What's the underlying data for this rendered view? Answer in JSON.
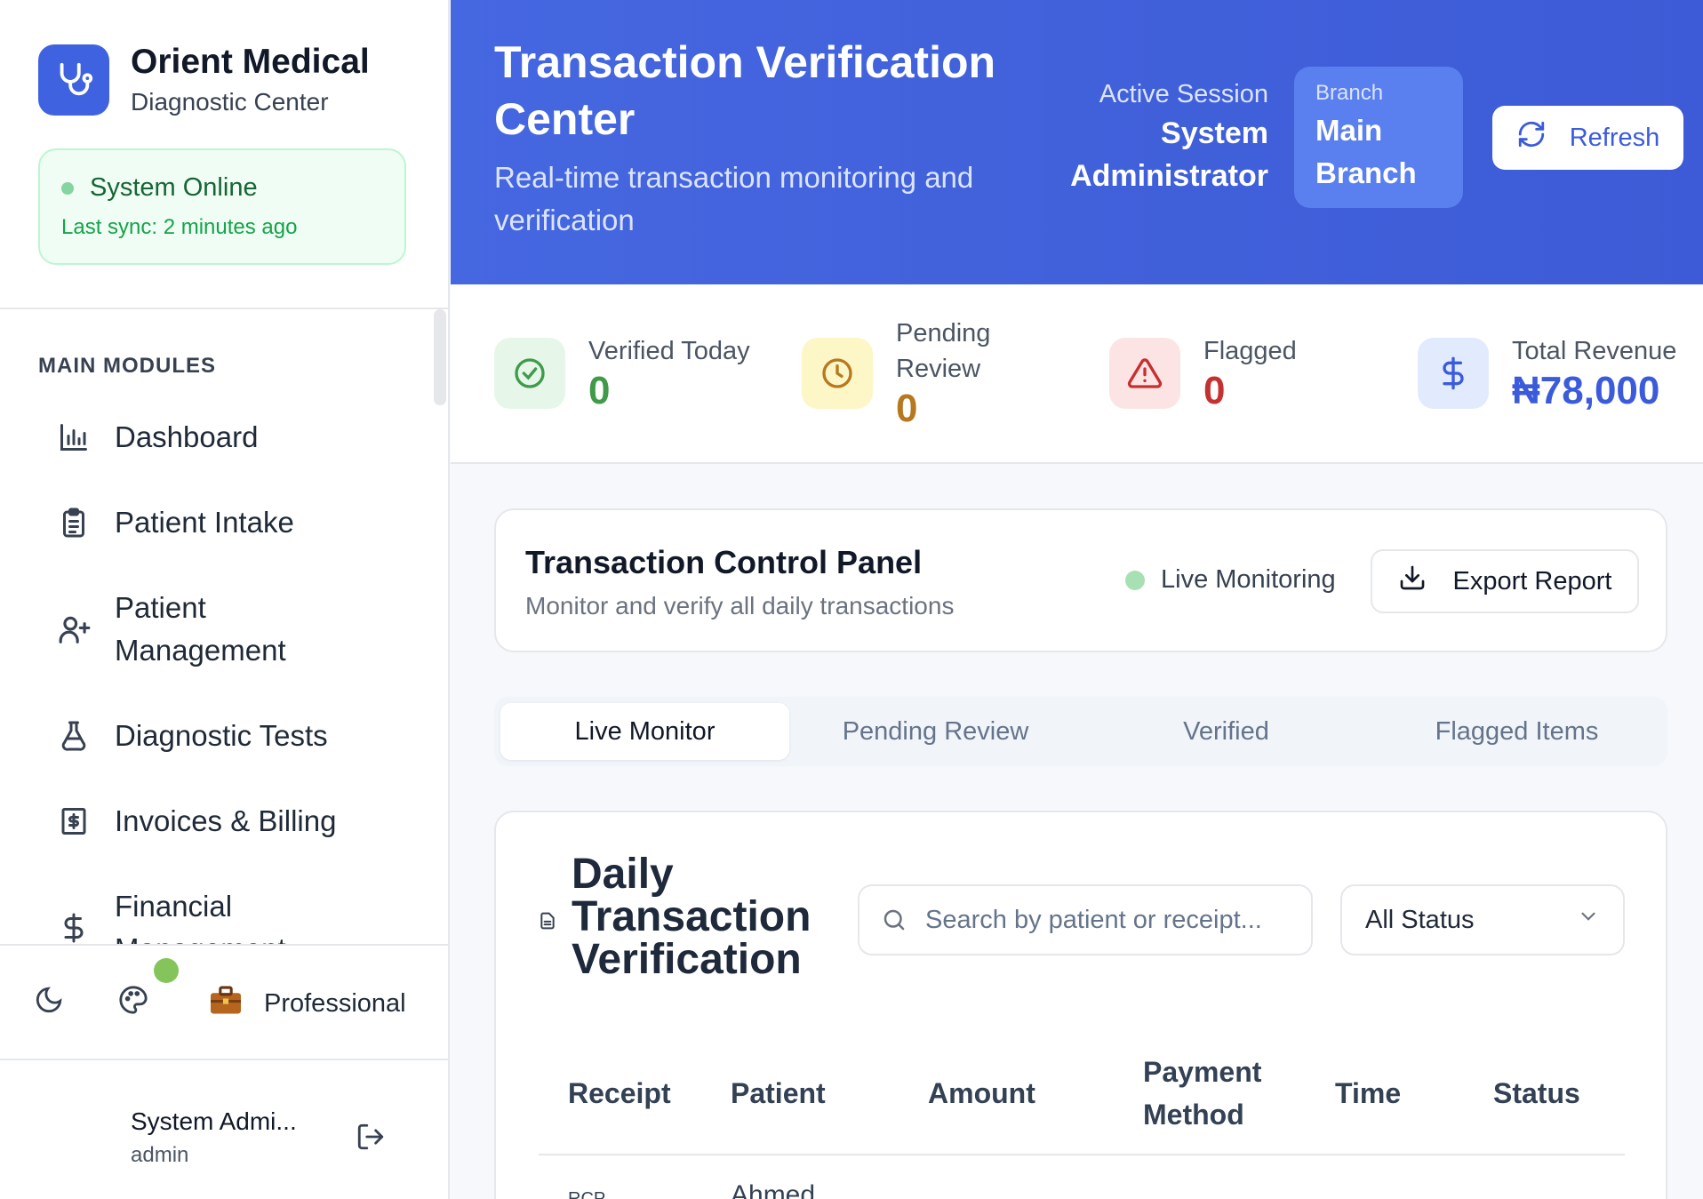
{
  "sidebar": {
    "brand_name": "Orient Medical",
    "brand_sub": "Diagnostic Center",
    "status_title": "System Online",
    "status_sync": "Last sync: 2 minutes ago",
    "section_heading": "MAIN MODULES",
    "items": [
      {
        "label": "Dashboard",
        "icon": "bar-chart-icon"
      },
      {
        "label": "Patient Intake",
        "icon": "clipboard-icon"
      },
      {
        "label": "Patient Management",
        "icon": "user-plus-icon"
      },
      {
        "label": "Diagnostic Tests",
        "icon": "flask-icon"
      },
      {
        "label": "Invoices & Billing",
        "icon": "receipt-icon"
      },
      {
        "label": "Financial Management",
        "icon": "dollar-icon"
      }
    ],
    "theme_label": "Professional",
    "user_name": "System Admi...",
    "user_role": "admin"
  },
  "header": {
    "title": "Transaction Verification Center",
    "subtitle": "Real-time transaction monitoring and verification",
    "session_label": "Active Session",
    "session_value": "System Administrator",
    "branch_label": "Branch",
    "branch_value": "Main Branch",
    "refresh_label": "Refresh"
  },
  "stats": [
    {
      "label": "Verified Today",
      "value": "0",
      "color": "#3f9a4a",
      "icon": "check-circle-icon"
    },
    {
      "label": "Pending Review",
      "value": "0",
      "color": "#b7791f",
      "icon": "clock-icon"
    },
    {
      "label": "Flagged",
      "value": "0",
      "color": "#c53030",
      "icon": "warning-icon"
    },
    {
      "label": "Total Revenue",
      "value": "₦78,000",
      "color": "#3b5bdb",
      "icon": "dollar-icon"
    }
  ],
  "panel": {
    "title": "Transaction Control Panel",
    "subtitle": "Monitor and verify all daily transactions",
    "live_label": "Live Monitoring",
    "export_label": "Export Report"
  },
  "tabs": [
    "Live Monitor",
    "Pending Review",
    "Verified",
    "Flagged Items"
  ],
  "table": {
    "title": "Daily Transaction Verification",
    "search_placeholder": "Search by patient or receipt...",
    "status_filter": "All Status",
    "columns": [
      "Receipt",
      "Patient",
      "Amount",
      "Payment Method",
      "Time",
      "Status"
    ],
    "first_row": {
      "receipt": "RCP",
      "patient": "Ahmed"
    }
  },
  "colors": {
    "accent": "#3f63e0",
    "online": "#84c45a"
  }
}
